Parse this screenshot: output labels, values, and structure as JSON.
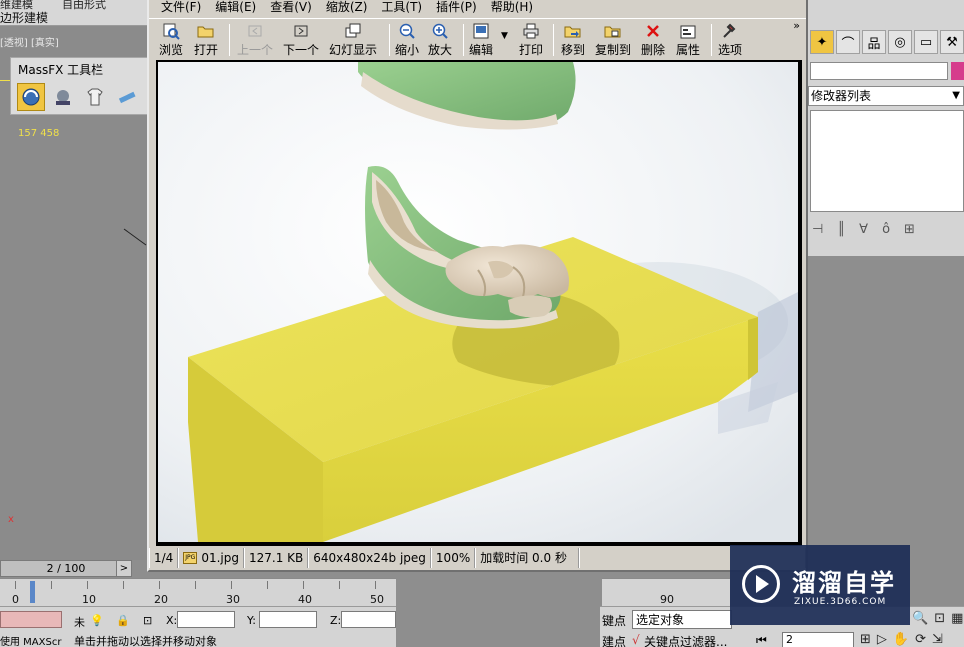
{
  "app": {
    "ribbon_row1": "维建模",
    "ribbon_row1b": "自由形式",
    "ribbon_row2": "边形建模",
    "viewport_label": "[透视] [真实]",
    "massfx_title": "MassFX 工具栏",
    "poly_count": "157 458",
    "axis_x_label": "x",
    "timeline": "2 / 100",
    "timeline_next": ">",
    "ruler_labels": [
      "0",
      "10",
      "20",
      "30",
      "40",
      "50"
    ],
    "ruler_right_label": "90",
    "coord_x": "X:",
    "coord_y": "Y:",
    "coord_z": "Z:",
    "left_hint": "使用 MAXScr",
    "prompt": "单击并拖动以选择并移动对象",
    "prompt_prefix": "未",
    "modifier_list": "修改器列表",
    "set_key_label": "键点",
    "selected_object": "选定对象",
    "key_filter_label": "建点",
    "key_filter_btn": "关键点过滤器...",
    "frame_value": "2"
  },
  "viewer": {
    "menu": [
      "文件(F)",
      "编辑(E)",
      "查看(V)",
      "缩放(Z)",
      "工具(T)",
      "插件(P)",
      "帮助(H)"
    ],
    "toolbar": {
      "browse": "浏览",
      "open": "打开",
      "prev": "上一个",
      "next": "下一个",
      "slideshow": "幻灯显示",
      "zoom_out": "缩小",
      "zoom_in": "放大",
      "edit": "编辑",
      "print": "打印",
      "move_to": "移到",
      "copy_to": "复制到",
      "delete": "删除",
      "properties": "属性",
      "options": "选项",
      "more": "»"
    },
    "status": {
      "index": "1/4",
      "filename": "01.jpg",
      "filesize": "127.1 KB",
      "dimensions": "640x480x24b jpeg",
      "zoom": "100%",
      "load_time": "加载时间 0.0 秒"
    },
    "file_type_badge": "JPG"
  },
  "watermark": {
    "cn": "溜溜自学",
    "en": "ZIXUE.3D66.COM"
  },
  "colors": {
    "box_yellow": "#e9df4e",
    "shoe_green": "#8fc48a",
    "watermark_bg": "#1c2c56",
    "active_tool": "#f0c542"
  }
}
